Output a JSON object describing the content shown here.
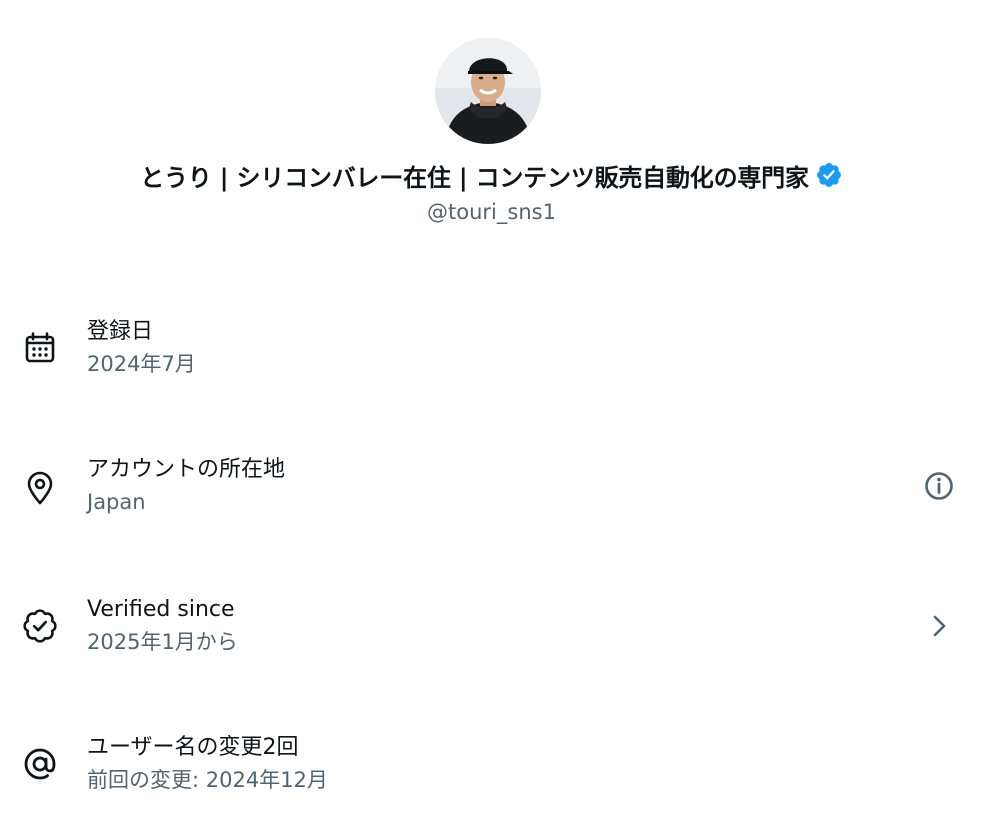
{
  "profile": {
    "display_name": "とうり | シリコンバレー在住 | コンテンツ販売自動化の専門家",
    "username": "@touri_sns1",
    "avatar_icon": "user-avatar-photo",
    "verified_icon": "verified-badge-icon",
    "verified_color": "#1d9bf0"
  },
  "rows": [
    {
      "id": "joined",
      "icon": "calendar-icon",
      "title": "登録日",
      "subtitle": "2024年7月",
      "trailing": null
    },
    {
      "id": "location",
      "icon": "location-pin-icon",
      "title": "アカウントの所在地",
      "subtitle": "Japan",
      "trailing": "info-icon"
    },
    {
      "id": "verified",
      "icon": "verified-outline-icon",
      "title": "Verified since",
      "subtitle": "2025年1月から",
      "trailing": "chevron-right-icon"
    },
    {
      "id": "username-changes",
      "icon": "at-sign-icon",
      "title": "ユーザー名の変更2回",
      "subtitle": "前回の変更: 2024年12月",
      "trailing": null
    }
  ],
  "colors": {
    "text_primary": "#0f1419",
    "text_secondary": "#536471",
    "background": "#ffffff"
  }
}
